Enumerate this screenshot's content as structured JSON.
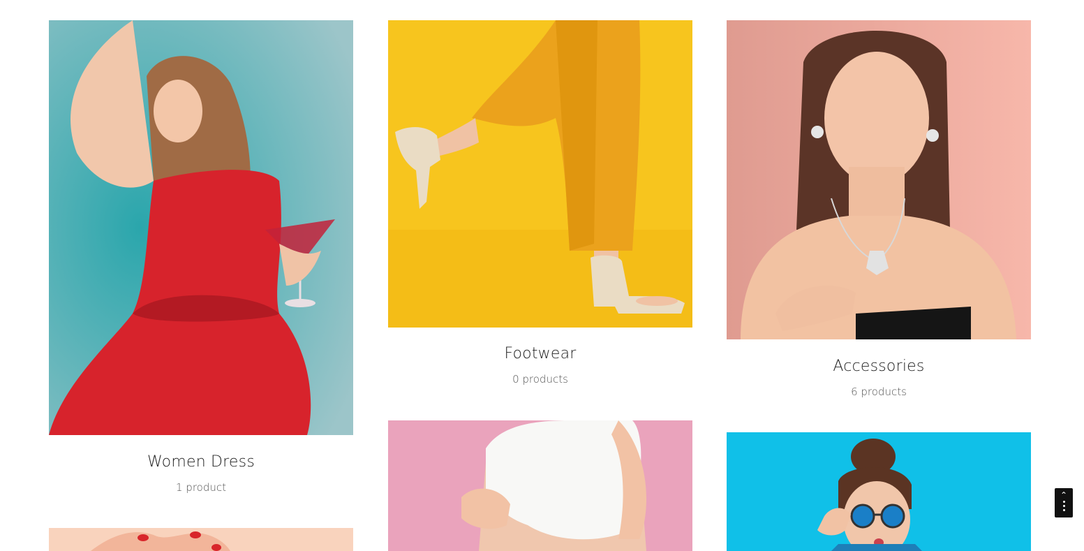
{
  "categories": [
    {
      "title": "Women Dress",
      "count": "1 product",
      "image": "woman-red-dress-photo",
      "bg": "#7fb8bf"
    },
    {
      "title": "Footwear",
      "count": "0 products",
      "image": "footwear-yellow-photo",
      "bg": "#f7c51e"
    },
    {
      "title": "Accessories",
      "count": "6 products",
      "image": "accessories-jewelry-photo",
      "bg": "#e9a596"
    },
    {
      "title": "",
      "count": "",
      "image": "nails-photo",
      "bg": "#f9d3bd"
    },
    {
      "title": "",
      "count": "",
      "image": "white-top-pink-photo",
      "bg": "#eaa3bc"
    },
    {
      "title": "",
      "count": "",
      "image": "sunglasses-blue-photo",
      "bg": "#10c0e8"
    }
  ],
  "scroll_top": {
    "icon": "chevron-up-icon"
  }
}
